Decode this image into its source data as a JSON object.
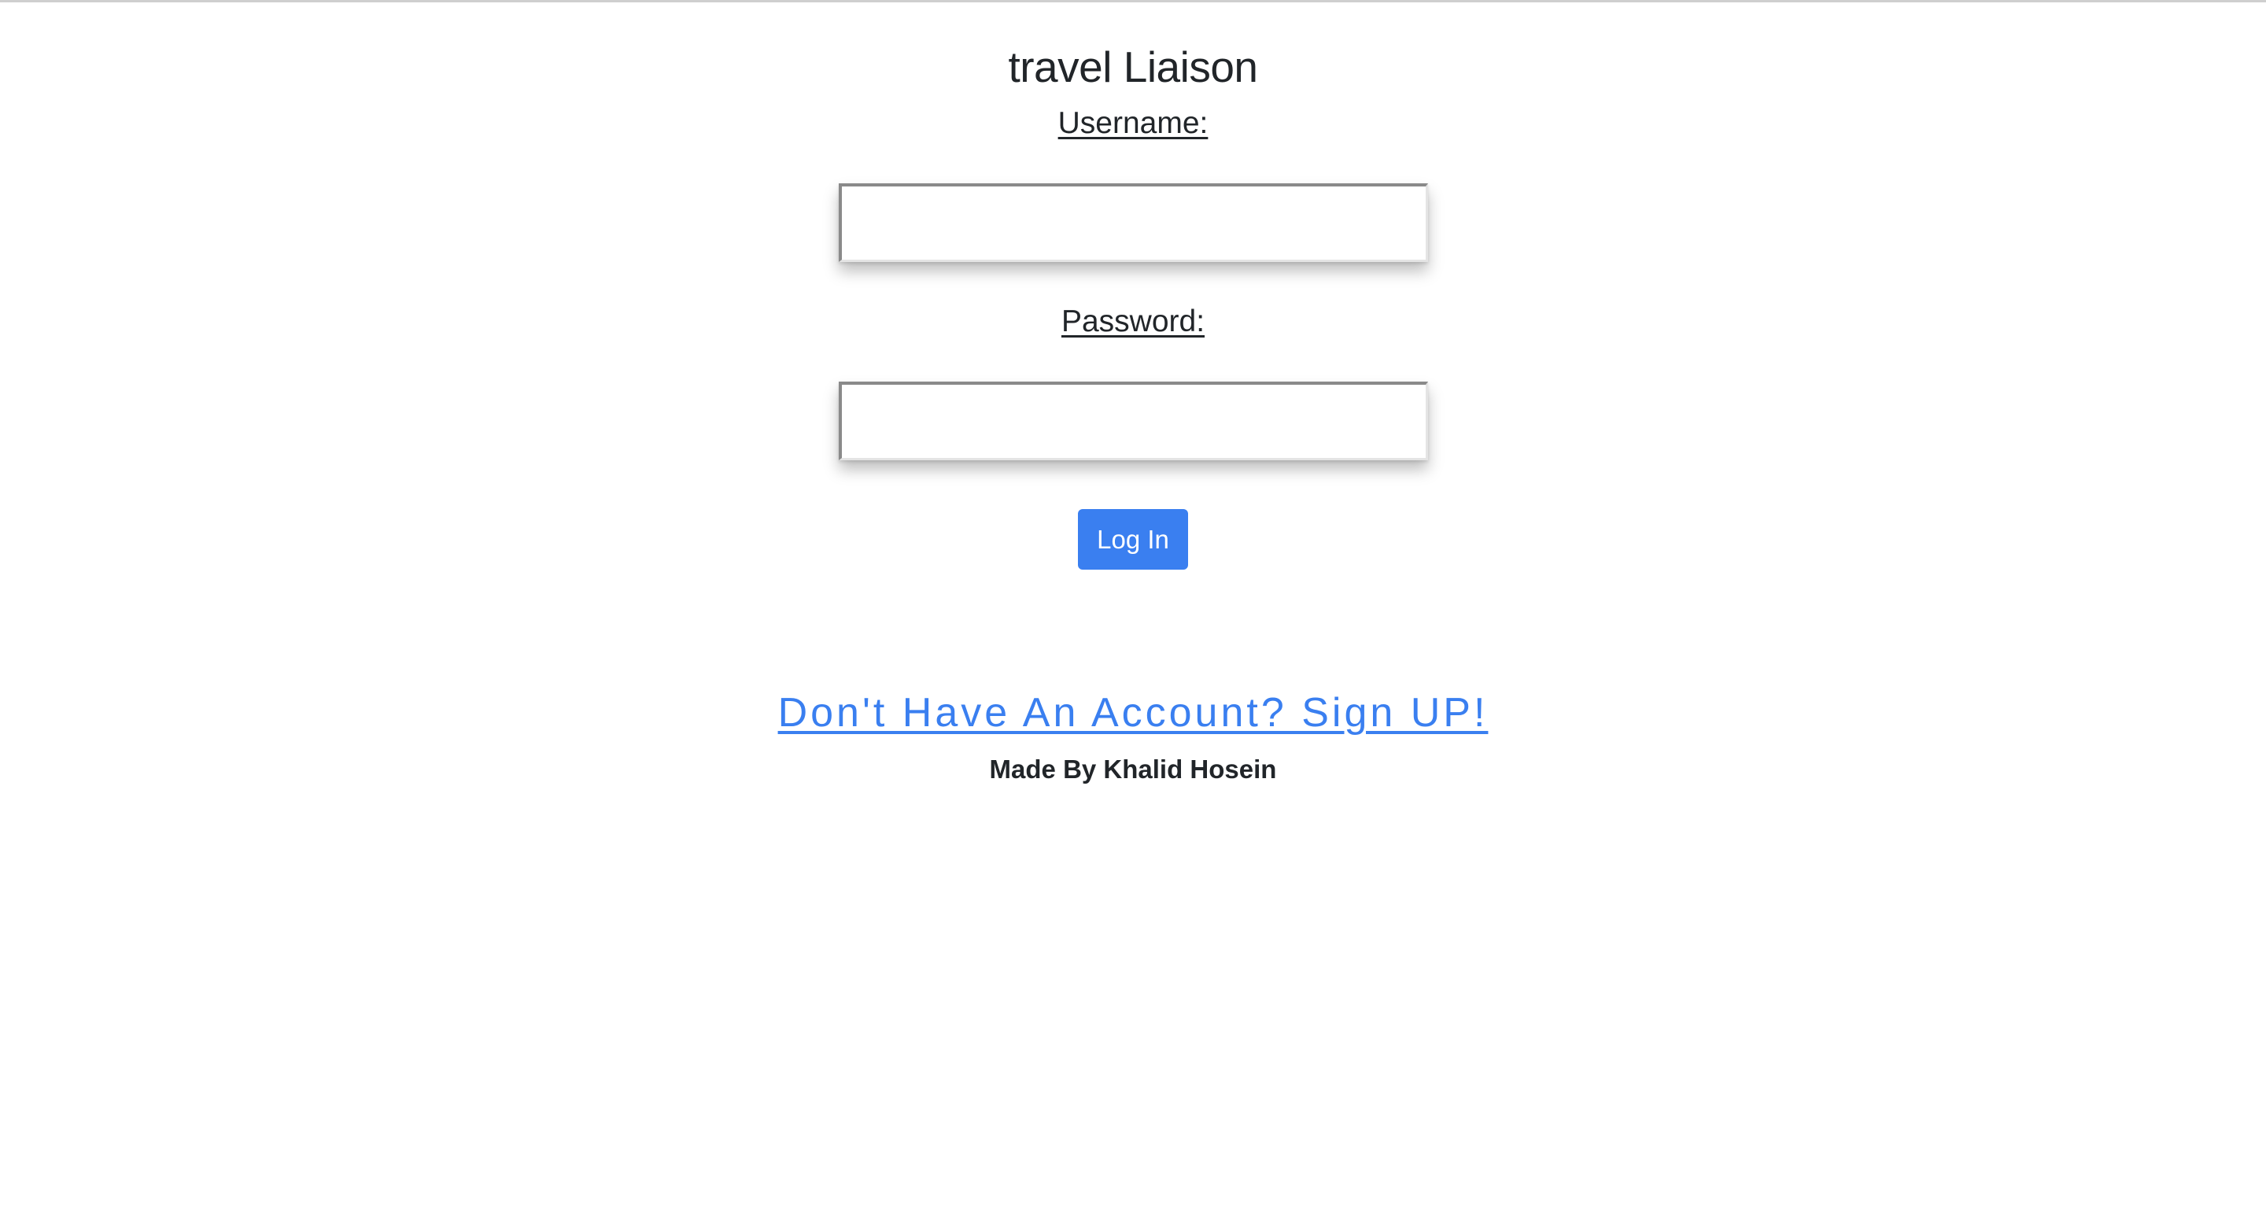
{
  "app": {
    "title": "travel Liaison"
  },
  "login_form": {
    "username_label": "Username:",
    "username_value": "",
    "username_placeholder": "",
    "password_label": "Password:",
    "password_value": "",
    "password_placeholder": "",
    "submit_label": "Log In"
  },
  "signup": {
    "link_text": "Don't Have An Account? Sign UP!"
  },
  "footer": {
    "credit": "Made By Khalid Hosein"
  },
  "colors": {
    "accent": "#3a7ff0",
    "text": "#212529",
    "background": "#ffffff"
  }
}
